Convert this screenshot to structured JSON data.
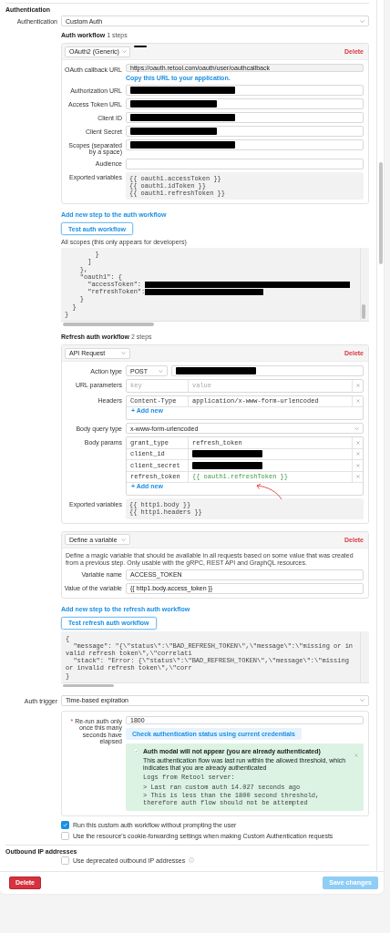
{
  "authentication": {
    "section_title": "Authentication",
    "label": "Authentication",
    "value": "Custom Auth"
  },
  "auth_workflow": {
    "title": "**Auth workflow** 1 steps",
    "steps": [
      {
        "type": "OAuth2 (Generic)",
        "name_redacted": true,
        "delete": "Delete",
        "fields": [
          {
            "kind": "readonly",
            "label": "OAuth callback URL",
            "value": "https://oauth.retool.com/oauth/user/oauthcallback",
            "hint": "Copy this URL to your application."
          },
          {
            "kind": "text",
            "label": "Authorization URL",
            "redacted": true
          },
          {
            "kind": "text",
            "label": "Access Token URL",
            "redacted": true
          },
          {
            "kind": "text",
            "label": "Client ID",
            "redacted": true
          },
          {
            "kind": "text",
            "label": "Client Secret",
            "redacted": true
          },
          {
            "kind": "text",
            "label": "Scopes (separated by a space)",
            "redacted": true
          },
          {
            "kind": "text",
            "label": "Audience",
            "redacted": false
          },
          {
            "kind": "code",
            "label": "Exported variables",
            "lines": [
              "{{ oauth1.accessToken }}",
              "{{ oauth1.idToken }}",
              "{{ oauth1.refreshToken }}"
            ]
          }
        ]
      }
    ],
    "add_step_link": "Add new step to the auth workflow",
    "test_button": "Test auth workflow",
    "scopes_note": "All scopes (this only appears for developers)",
    "scopes_output": [
      {
        "text": "        }",
        "redacted": false
      },
      {
        "text": "      ]",
        "redacted": false
      },
      {
        "text": "    },",
        "redacted": false
      },
      {
        "text": "    \"oauth1\": {",
        "redacted": false
      },
      {
        "text": "      \"accessToken\": ",
        "redacted": true
      },
      {
        "text": "      \"refreshToken\":",
        "redacted": true
      },
      {
        "text": "    }",
        "redacted": false
      },
      {
        "text": "  }",
        "redacted": false
      },
      {
        "text": "}",
        "redacted": false
      }
    ]
  },
  "refresh_workflow": {
    "title": "**Refresh auth workflow** 2 steps",
    "steps": [
      {
        "type": "API Request",
        "name_redacted": false,
        "delete": "Delete",
        "fields": [
          {
            "kind": "method_url",
            "label": "Action type",
            "method": "POST",
            "redacted": true
          },
          {
            "kind": "pairs",
            "label": "URL parameters",
            "rows": [
              {
                "key_placeholder": "key",
                "value_placeholder": "value"
              }
            ]
          },
          {
            "kind": "pairs",
            "label": "Headers",
            "add_label": "+ Add new",
            "rows": [
              {
                "key": "Content-Type",
                "value": "application/x-www-form-urlencoded",
                "template": false,
                "redacted": false,
                "annotated": false
              }
            ]
          },
          {
            "kind": "select",
            "label": "Body query type",
            "value": "x-www-form-urlencoded"
          },
          {
            "kind": "pairs",
            "label": "Body params",
            "add_label": "+ Add new",
            "rows": [
              {
                "key": "grant_type",
                "value": "refresh_token",
                "template": false,
                "redacted": false,
                "annotated": false
              },
              {
                "key": "client_id",
                "template": false,
                "redacted": true,
                "annotated": false
              },
              {
                "key": "client_secret",
                "template": false,
                "redacted": true,
                "annotated": false
              },
              {
                "key": "refresh_token",
                "value": "{{ oauth1.refreshToken }}",
                "template": true,
                "redacted": false,
                "annotated": true
              }
            ]
          },
          {
            "kind": "code",
            "label": "Exported variables",
            "lines": [
              "{{ http1.body }}",
              "{{ http1.headers }}"
            ]
          }
        ]
      },
      {
        "type": "Define a variable",
        "name_redacted": false,
        "delete": "Delete",
        "fields": [
          {
            "kind": "description",
            "text": "Define a magic variable that should be available in all requests based on some value that was created from a previous step. Only usable with the gRPC, REST API and GraphQL resources."
          },
          {
            "kind": "text",
            "label": "Variable name",
            "value": "ACCESS_TOKEN",
            "redacted": false
          },
          {
            "kind": "text",
            "label": "Value of the variable",
            "value": "{{ http1.body.access_token }}",
            "redacted": false
          }
        ]
      }
    ],
    "add_step_link": "Add new step to the refresh auth workflow",
    "test_button": "Test refresh auth workflow",
    "test_output": [
      {
        "text": "{",
        "redacted": false
      },
      {
        "text": "  \"message\": \"{\\\"status\\\":\\\"BAD_REFRESH_TOKEN\\\",\\\"message\\\":\\\"missing or invalid refresh token\\\",\\\"correlati",
        "redacted": false
      },
      {
        "text": "  \"stack\": \"Error: {\\\"status\\\":\\\"BAD_REFRESH_TOKEN\\\",\\\"message\\\":\\\"missing or invalid refresh token\\\",\\\"corr",
        "redacted": false
      },
      {
        "text": "}",
        "redacted": false
      }
    ]
  },
  "auth_trigger": {
    "label": "Auth trigger",
    "value": "Time-based expiration",
    "expiry": {
      "required_mark": "*",
      "label": "Re-run auth only once this many seconds have elapsed",
      "value": "1800",
      "check_button": "Check authentication status using current credentials",
      "alert": {
        "title": "Auth modal will not appear (you are already authenticated)",
        "message": "This authentication flow was last run within the allowed threshold, which indicates that you are already authenticated",
        "log_title": "Logs from Retool server:",
        "logs": [
          "> Last ran custom auth 14.027 seconds ago",
          "> This is less than the 1800 second threshold, therefore auth flow should not be attempted"
        ]
      }
    }
  },
  "auth_options": [
    {
      "label": "Run this custom auth workflow without prompting the user",
      "checked": true,
      "info": false
    },
    {
      "label": "Use the resource's cookie-forwarding settings when making Custom Authentication requests",
      "checked": false,
      "info": false
    }
  ],
  "outbound": {
    "title": "Outbound IP addresses",
    "options": [
      {
        "label": "Use deprecated outbound IP addresses",
        "checked": false,
        "info": true
      }
    ]
  },
  "footer": {
    "delete": "Delete",
    "save": {
      "label": "Save changes",
      "disabled": true
    }
  }
}
